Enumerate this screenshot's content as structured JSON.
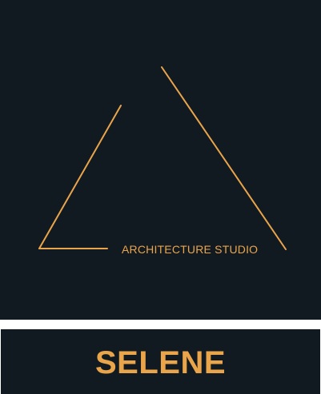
{
  "logo": {
    "tagline": "ARCHITECTURE STUDIO",
    "mark": "open-triangle-outline"
  },
  "brand": {
    "name": "SELENE"
  },
  "colors": {
    "background": "#121a21",
    "accent": "#eaa54b",
    "page": "#ffffff"
  }
}
